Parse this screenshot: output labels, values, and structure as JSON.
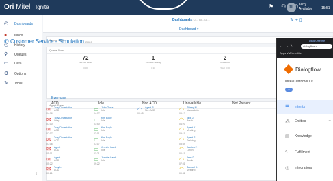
{
  "topbar": {
    "brand": "Ori",
    "brand_suffix": "Mitel",
    "app_name": "Ignite",
    "user_initials": "TL",
    "user_name": "Terry",
    "user_status": "Available",
    "clock": "15:51"
  },
  "sidebar": {
    "items": [
      {
        "label": "Dashboards",
        "icon": "dashboard-icon"
      },
      {
        "label": "Inbox",
        "icon": "inbox-icon"
      },
      {
        "label": "History",
        "icon": "history-icon"
      },
      {
        "label": "Queues",
        "icon": "queues-icon"
      },
      {
        "label": "Data",
        "icon": "data-icon"
      },
      {
        "label": "Options",
        "icon": "gear-icon"
      },
      {
        "label": "Tools",
        "icon": "wrench-icon"
      }
    ]
  },
  "tabbar": {
    "active_tab": "Dashboards",
    "other_tabs": "QI... CI... BI... DI..."
  },
  "subbar": {
    "dropdown": "Dashboard ▾"
  },
  "panels": {
    "queue_state": "Queue State",
    "queue_now": "Queue Now",
    "agent_state": "Agent State"
  },
  "queue": {
    "title": "Customer Service - Simulation",
    "title_suffix": "P001",
    "stats": [
      {
        "value": "72",
        "label": "Service Level",
        "sub": "0:00"
      },
      {
        "value": "1",
        "label": "Contacts Waiting",
        "sub": "0:10"
      },
      {
        "value": "2",
        "label": "Answered",
        "sub": "Total: 0:00"
      }
    ]
  },
  "agents": {
    "section_label": "Everyone",
    "columns": [
      "ACD",
      "Idle",
      "Non ACD",
      "Unavailable",
      "Not Present"
    ],
    "acd": [
      {
        "name": "Tony Devastation",
        "status": "ACD",
        "time": "04:16",
        "color": "red"
      },
      {
        "name": "Tony Devastation",
        "status": "Wrap",
        "time": "07:10",
        "color": "red"
      },
      {
        "name": "Tony Devastation",
        "status": "ACD",
        "time": "07:17",
        "color": "red"
      },
      {
        "name": "Tony Devastation",
        "status": "ACD",
        "time": "07:16",
        "color": "red"
      },
      {
        "name": "Agent",
        "status": "ACD",
        "time": "05:11",
        "color": "red"
      },
      {
        "name": "Agent",
        "status": "ACD",
        "time": "05:22",
        "color": "red"
      },
      {
        "name": "Tony L.",
        "status": "ACD",
        "time": "00:21",
        "color": "red"
      }
    ],
    "idle": [
      {
        "name": "John Glass",
        "status": "Idle",
        "time": "04:17",
        "color": "green"
      },
      {
        "name": "Kim Boyle",
        "status": "Idle",
        "time": "03:50",
        "color": "green"
      },
      {
        "name": "Kim Boyle",
        "status": "Idle",
        "time": "03:11",
        "color": "green"
      },
      {
        "name": "Kim Boyle",
        "status": "Idle",
        "time": "07:17",
        "color": "green"
      },
      {
        "name": "Jennifer Lamb",
        "status": "Idle",
        "time": "01:21",
        "color": "green"
      },
      {
        "name": "Jennifer Lamb",
        "status": "Idle",
        "time": "09:22",
        "color": "green"
      }
    ],
    "non_acd": [
      {
        "name": "Agent R.",
        "status": "Non ACD",
        "time": "00:45",
        "color": "blue"
      }
    ],
    "unavailable": [
      {
        "name": "Shirley M.",
        "status": "Unavailable",
        "time": "05:17",
        "color": "yellow"
      },
      {
        "name": "Nick J.",
        "status": "Break",
        "time": "04:20",
        "color": "yellow"
      },
      {
        "name": "Agent K.",
        "status": "Meeting",
        "time": "09:11",
        "color": "yellow"
      },
      {
        "name": "Agent S.",
        "status": "Training",
        "time": "03:49",
        "color": "yellow"
      },
      {
        "name": "Jessica F.",
        "status": "Lunch",
        "time": "00:11",
        "color": "yellow"
      },
      {
        "name": "Jane D.",
        "status": "Break",
        "time": "07:01",
        "color": "yellow"
      },
      {
        "name": "Samuel K.",
        "status": "Meeting",
        "time": "00:31",
        "color": "yellow"
      }
    ]
  },
  "phone": {
    "link": "DBB Offense",
    "url": "dialogflow.c",
    "bookmarks": "Apps  VM  Unedifie",
    "brand": "Dialogflow",
    "agent_name": "Mitel-Customer1",
    "pill": "en",
    "menu": [
      {
        "label": "Intents",
        "icon": "intents-icon"
      },
      {
        "label": "Entities",
        "icon": "entities-icon"
      },
      {
        "label": "Knowledge",
        "icon": "knowledge-icon"
      },
      {
        "label": "Fulfillment",
        "icon": "fulfillment-icon"
      },
      {
        "label": "Integrations",
        "icon": "integrations-icon"
      }
    ]
  }
}
